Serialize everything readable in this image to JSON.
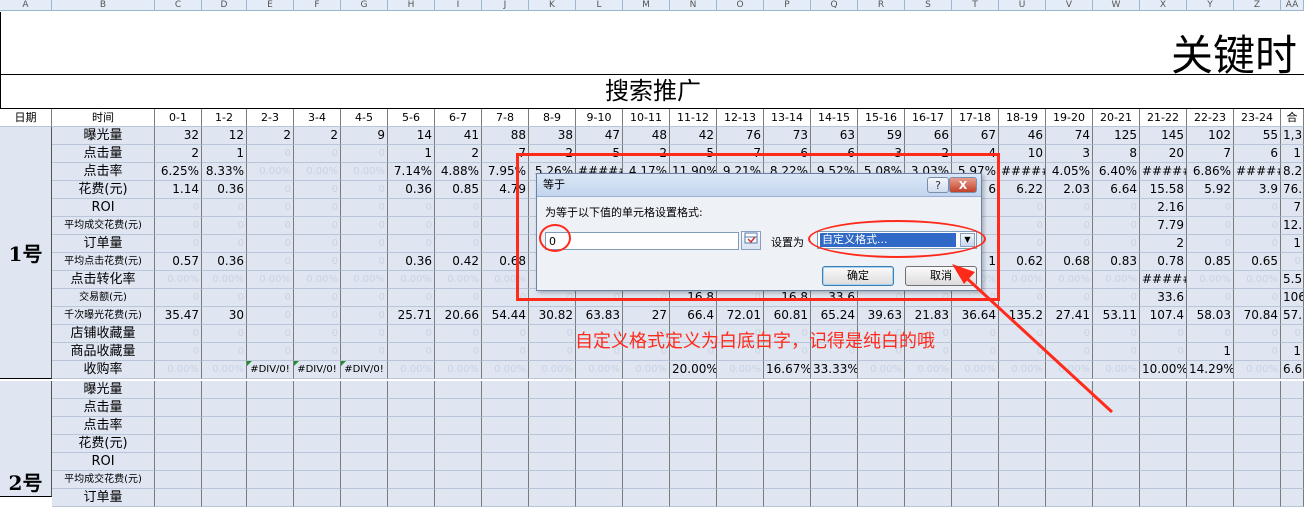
{
  "columns": [
    "A",
    "B",
    "C",
    "D",
    "E",
    "F",
    "G",
    "H",
    "I",
    "J",
    "K",
    "L",
    "M",
    "N",
    "O",
    "P",
    "Q",
    "R",
    "S",
    "T",
    "U",
    "V",
    "W",
    "X",
    "Y",
    "Z",
    "AA"
  ],
  "title": "关键时",
  "subtitle": "搜索推广",
  "header_row": {
    "date": "日期",
    "time": "时间",
    "hours": [
      "0-1",
      "1-2",
      "2-3",
      "3-4",
      "4-5",
      "5-6",
      "6-7",
      "7-8",
      "8-9",
      "9-10",
      "10-11",
      "11-12",
      "12-13",
      "13-14",
      "14-15",
      "15-16",
      "16-17",
      "17-18",
      "18-19",
      "19-20",
      "20-21",
      "21-22",
      "22-23",
      "23-24",
      "合"
    ]
  },
  "block1": {
    "date": "1号",
    "rows": [
      {
        "metric": "曝光量",
        "values": [
          "32",
          "12",
          "2",
          "2",
          "9",
          "14",
          "41",
          "88",
          "38",
          "47",
          "48",
          "42",
          "76",
          "73",
          "63",
          "59",
          "66",
          "67",
          "46",
          "74",
          "125",
          "145",
          "102",
          "55",
          "1,3"
        ]
      },
      {
        "metric": "点击量",
        "values": [
          "2",
          "1",
          "0",
          "0",
          "0",
          "1",
          "2",
          "7",
          "2",
          "5",
          "2",
          "5",
          "7",
          "6",
          "6",
          "3",
          "2",
          "4",
          "10",
          "3",
          "8",
          "20",
          "7",
          "6",
          "1"
        ]
      },
      {
        "metric": "点击率",
        "values": [
          "6.25%",
          "8.33%",
          "0.00%",
          "0.00%",
          "0.00%",
          "7.14%",
          "4.88%",
          "7.95%",
          "5.26%",
          "#####",
          "4.17%",
          "11.90%",
          "9.21%",
          "8.22%",
          "9.52%",
          "5.08%",
          "3.03%",
          "5.97%",
          "#####",
          "4.05%",
          "6.40%",
          "#####",
          "6.86%",
          "#####",
          "8.2"
        ]
      },
      {
        "metric": "花费(元)",
        "values": [
          "1.14",
          "0.36",
          "0",
          "0",
          "0",
          "0.36",
          "0.85",
          "4.79",
          "",
          "",
          "",
          "",
          "",
          "",
          "",
          "",
          "",
          "6",
          "6.22",
          "2.03",
          "6.64",
          "15.58",
          "5.92",
          "3.9",
          "76."
        ]
      },
      {
        "metric": "ROI",
        "values": [
          "0",
          "0",
          "0",
          "0",
          "0",
          "0",
          "0",
          "",
          "",
          "",
          "",
          "",
          "",
          "",
          "",
          "",
          "",
          "",
          "0",
          "0",
          "0",
          "2.16",
          "0",
          "0",
          "7"
        ]
      },
      {
        "metric": "平均成交花费(元)",
        "values": [
          "0",
          "0",
          "0",
          "0",
          "0",
          "0",
          "0",
          "",
          "",
          "",
          "",
          "",
          "",
          "",
          "",
          "",
          "",
          "",
          "0",
          "0",
          "0",
          "7.79",
          "0",
          "0",
          "12."
        ]
      },
      {
        "metric": "订单量",
        "values": [
          "0",
          "0",
          "0",
          "0",
          "0",
          "0",
          "0",
          "",
          "",
          "",
          "",
          "",
          "",
          "",
          "",
          "",
          "",
          "",
          "0",
          "0",
          "0",
          "2",
          "0",
          "0",
          "1"
        ]
      },
      {
        "metric": "平均点击花费(元)",
        "values": [
          "0.57",
          "0.36",
          "0",
          "0",
          "0",
          "0.36",
          "0.42",
          "0.68",
          "",
          "",
          "",
          "",
          "",
          "",
          "",
          "",
          "",
          "1",
          "0.62",
          "0.68",
          "0.83",
          "0.78",
          "0.85",
          "0.65",
          "0"
        ]
      },
      {
        "metric": "点击转化率",
        "values": [
          "0.00%",
          "0.00%",
          "0.00%",
          "0.00%",
          "0.00%",
          "0.00%",
          "0.00%",
          "0.00%",
          "0.00%",
          "0.00%",
          "0.00%",
          "0.00%",
          "0.00%",
          "0.00%",
          "0.00%",
          "0.00%",
          "0.00%",
          "0.00%",
          "0.00%",
          "0.00%",
          "0.00%",
          "#####",
          "0.00%",
          "0.00%",
          "5.5"
        ]
      },
      {
        "metric": "交易额(元)",
        "values": [
          "0",
          "0",
          "0",
          "0",
          "0",
          "0",
          "0",
          "0",
          "0",
          "0",
          "0",
          "16.8",
          "0",
          "16.8",
          "33.6",
          "0",
          "0",
          "0",
          "0",
          "0",
          "0",
          "33.6",
          "0",
          "0",
          "106"
        ]
      },
      {
        "metric": "千次曝光花费(元)",
        "values": [
          "35.47",
          "30",
          "0",
          "0",
          "0",
          "25.71",
          "20.66",
          "54.44",
          "30.82",
          "63.83",
          "27",
          "66.4",
          "72.01",
          "60.81",
          "65.24",
          "39.63",
          "21.83",
          "36.64",
          "135.2",
          "27.41",
          "53.11",
          "107.4",
          "58.03",
          "70.84",
          "57."
        ]
      },
      {
        "metric": "店铺收藏量",
        "values": [
          "0",
          "0",
          "0",
          "0",
          "0",
          "0",
          "0",
          "0",
          "0",
          "0",
          "0",
          "0",
          "0",
          "0",
          "0",
          "0",
          "0",
          "0",
          "0",
          "0",
          "0",
          "0",
          "0",
          "0",
          "0"
        ]
      },
      {
        "metric": "商品收藏量",
        "values": [
          "0",
          "0",
          "0",
          "0",
          "0",
          "0",
          "0",
          "0",
          "0",
          "0",
          "0",
          "0",
          "0",
          "0",
          "0",
          "0",
          "0",
          "0",
          "0",
          "0",
          "0",
          "0",
          "1",
          "0",
          "1"
        ]
      },
      {
        "metric": "收购率",
        "values": [
          "0.00%",
          "0.00%",
          "#DIV/0!",
          "#DIV/0!",
          "#DIV/0!",
          "0.00%",
          "0.00%",
          "0.00%",
          "0.00%",
          "0.00%",
          "0.00%",
          "20.00%",
          "0.00%",
          "16.67%",
          "33.33%",
          "0.00%",
          "0.00%",
          "0.00%",
          "0.00%",
          "0.00%",
          "0.00%",
          "10.00%",
          "14.29%",
          "0.00%",
          "6.6"
        ]
      }
    ]
  },
  "block2": {
    "date": "2号",
    "metrics": [
      "曝光量",
      "点击量",
      "点击率",
      "花费(元)",
      "ROI",
      "平均成交花费(元)",
      "订单量"
    ]
  },
  "dialog": {
    "title": "等于",
    "help": "?",
    "close": "X",
    "prompt": "为等于以下值的单元格设置格式:",
    "input_value": "0",
    "ref_icon": "range-select-icon",
    "set_label": "设置为",
    "format_value": "自定义格式...",
    "ok": "确定",
    "cancel": "取消"
  },
  "annotation": {
    "text": "自定义格式定义为白底白字，记得是纯白的哦",
    "color": "#ff2a1a"
  }
}
